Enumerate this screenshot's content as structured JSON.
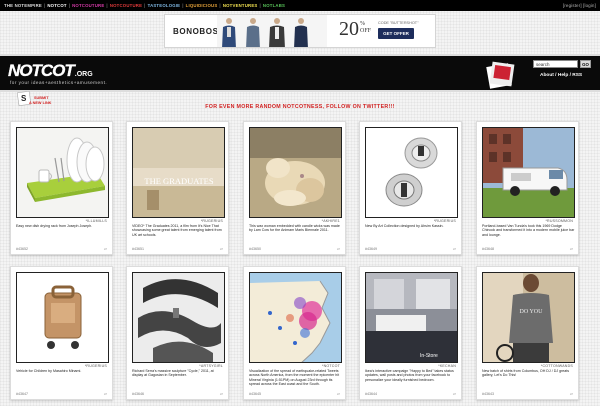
{
  "topnav": {
    "items": [
      {
        "label": "THE NOTEMPIRE",
        "color": "#dddddd"
      },
      {
        "label": "NOTCOT",
        "color": "#ffffff"
      },
      {
        "label": "NOTCOUTURE",
        "color": "#d63aa8"
      },
      {
        "label": "NOTCOUTURE",
        "color": "#e23b3b"
      },
      {
        "label": "TASTEOLOGIE",
        "color": "#7fb8e4"
      },
      {
        "label": "LIQUIDICIOUS",
        "color": "#e6a33a"
      },
      {
        "label": "NOTVENTURES",
        "color": "#f0e050"
      },
      {
        "label": "NOTLABS",
        "color": "#58c45a"
      }
    ],
    "account": "[register] [login]"
  },
  "ad": {
    "brand": "BONOBOS",
    "offer_big": "20",
    "offer_pct": "%",
    "offer_off": "OFF",
    "code": "CODE \"BUTTERSHOT\"",
    "button": "GET OFFER"
  },
  "header": {
    "logo": "NOTCOT",
    "logo_suffix": ".ORG",
    "tagline": "for your ideas+aesthetics+amusement.",
    "search_placeholder": "search",
    "search_button": "GO",
    "links": "About / Help / RSS"
  },
  "submit": {
    "line1": "SUBMIT",
    "line2": "A NEW LINK"
  },
  "twitter": {
    "text": "FOR EVEN MORE RANDOM NOTCOTNESS, FOLLOW ON TWITTER!!!"
  },
  "posts": [
    {
      "credit": "*ILLUMILLS",
      "caption": "Easy new dish drying rack from Joseph Joseph.",
      "num": "#43652"
    },
    {
      "credit": "*RUGERIUS",
      "caption": "VIDEO* The Graduates 2011, a film from It's Nice That showcasing some great talent from emerging talent from UK art schools.",
      "num": "#43651"
    },
    {
      "credit": "*AKHIRE1",
      "caption": "This wax woman embedded with candle wicks was made by Lam Cow for the Animam Maris Biennale 2011.",
      "num": "#43650"
    },
    {
      "credit": "*RUGERIUS",
      "caption": "New By Art Collection designed by Ahsim Kassin.",
      "num": "#43649"
    },
    {
      "credit": "*RUSSOMMON",
      "caption": "Portland-based Van Tunda's took this 1969 Dodge Chinook and transformed it into a modern mobile juice bar and lounge.",
      "num": "#43648"
    },
    {
      "credit": "*RUGERIUS",
      "caption": "Vehicle for Children by Masahiro Minami.",
      "num": "#43647"
    },
    {
      "credit": "*ARTSYGIRL",
      "caption": "Richard Serra's massive sculpture \"Cycle,\" 2011, at display at Gagosian in September.",
      "num": "#43646"
    },
    {
      "credit": "*NOTCOT",
      "caption": "Visualization of the spread of earthquake-related Tweets across North America, from the moment the epicenter hit Mineral Virginia (1:51PM) on August 23rd through its spread across the East coast and the South.",
      "num": "#43645"
    },
    {
      "credit": "*KECHAN",
      "caption": "Ikea's interactive campaign \"Happy to Bed\" takes status updates, wall posts and photos from your facebook to personalize your ideally furnished bedroom.",
      "num": "#43644"
    },
    {
      "credit": "*COTTONWANDS",
      "caption": "New batch of shirts from Columbus, OH DJ / DJ greats gallery, Let's Do This!",
      "num": "#43643"
    }
  ],
  "thumbs": {
    "graduates_title": "THE GRADUATES",
    "instore": "In-Store",
    "tshirt": "DO YOU"
  },
  "colors": {
    "accent_red": "#d22222",
    "bonobos_navy": "#1d2d5c"
  }
}
